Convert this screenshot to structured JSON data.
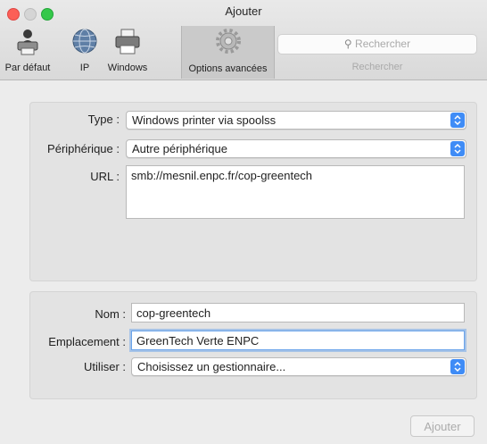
{
  "window": {
    "title": "Ajouter"
  },
  "toolbar": {
    "tools": [
      {
        "label": "Par défaut",
        "icon": "printer-default-icon"
      },
      {
        "label": "IP",
        "icon": "globe-icon"
      },
      {
        "label": "Windows",
        "icon": "printer-icon"
      },
      {
        "label": "Options avancées",
        "icon": "gear-icon",
        "selected": true
      }
    ],
    "search": {
      "placeholder": "Rechercher",
      "caption": "Rechercher"
    }
  },
  "form": {
    "type": {
      "label": "Type :",
      "value": "Windows printer via spoolss"
    },
    "device": {
      "label": "Périphérique :",
      "value": "Autre périphérique"
    },
    "url": {
      "label": "URL :",
      "value": "smb://mesnil.enpc.fr/cop-greentech"
    },
    "name": {
      "label": "Nom :",
      "value": "cop-greentech"
    },
    "location": {
      "label": "Emplacement :",
      "value": "GreenTech Verte ENPC"
    },
    "driver": {
      "label": "Utiliser :",
      "value": "Choisissez un gestionnaire..."
    }
  },
  "buttons": {
    "add": "Ajouter"
  },
  "colors": {
    "accent": "#3f8cf6",
    "close": "#fc5f57",
    "maximize": "#35c84a",
    "focus_ring": "#5b9beb"
  }
}
